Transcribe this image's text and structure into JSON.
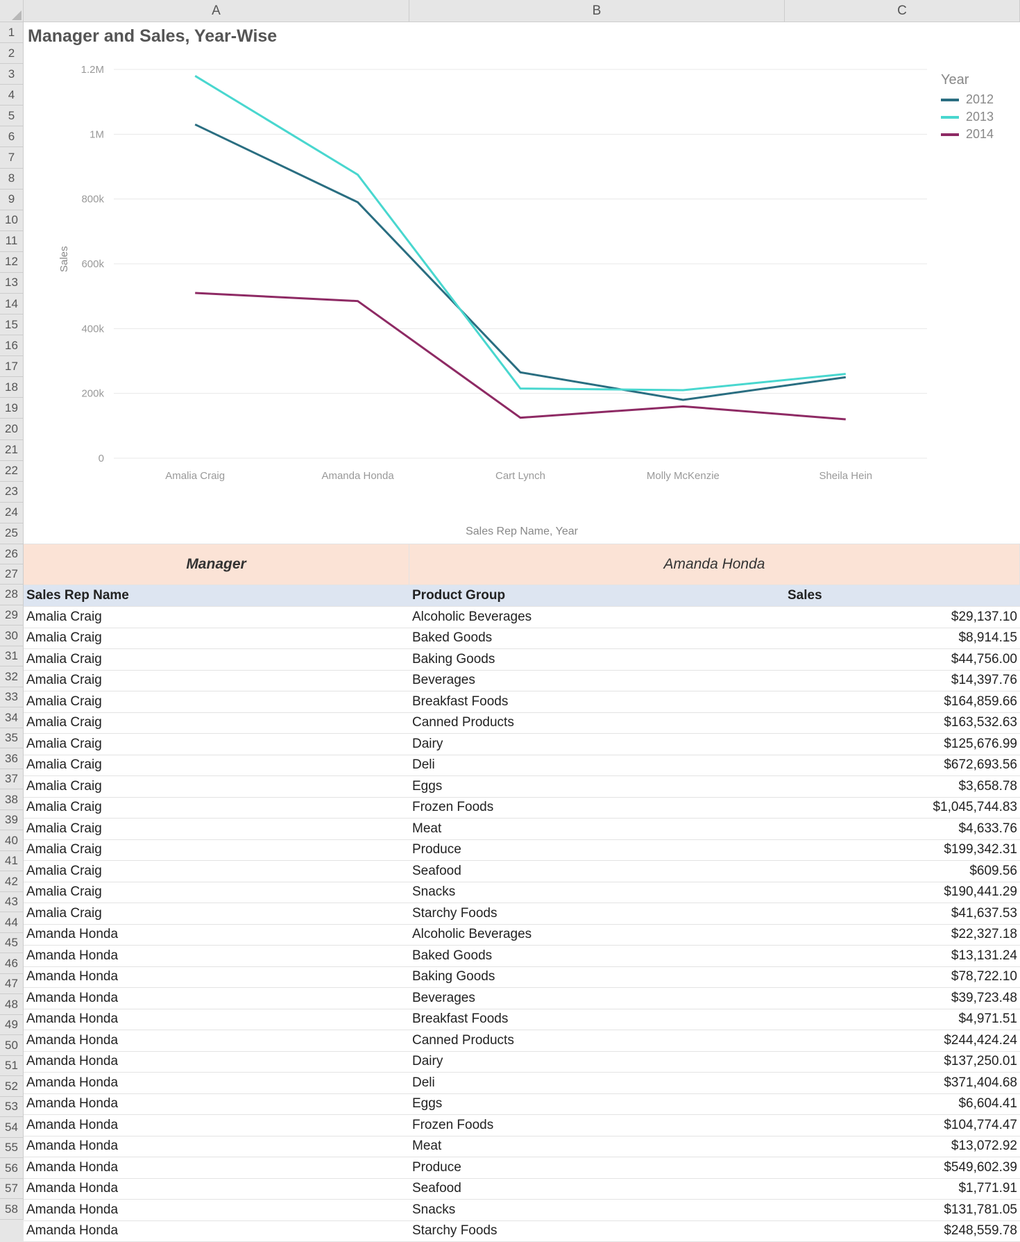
{
  "columns": [
    "A",
    "B",
    "C"
  ],
  "row_numbers_start": 1,
  "row_numbers_end": 58,
  "chart_title": "Manager and Sales, Year-Wise",
  "axis": {
    "ylabel": "Sales",
    "xtitle": "Sales Rep Name, Year"
  },
  "legend": {
    "title": "Year",
    "items": [
      {
        "name": "2012",
        "color": "#2a6e81"
      },
      {
        "name": "2013",
        "color": "#49d7cf"
      },
      {
        "name": "2014",
        "color": "#8e2a64"
      }
    ]
  },
  "chart_data": {
    "type": "line",
    "categories": [
      "Amalia Craig",
      "Amanda Honda",
      "Cart Lynch",
      "Molly McKenzie",
      "Sheila Hein"
    ],
    "series": [
      {
        "name": "2012",
        "color": "#2a6e81",
        "values": [
          1030000,
          790000,
          265000,
          180000,
          250000
        ]
      },
      {
        "name": "2013",
        "color": "#49d7cf",
        "values": [
          1180000,
          875000,
          215000,
          210000,
          260000
        ]
      },
      {
        "name": "2014",
        "color": "#8e2a64",
        "values": [
          510000,
          485000,
          125000,
          160000,
          120000
        ]
      }
    ],
    "title": "Manager and Sales, Year-Wise",
    "xlabel": "Sales Rep Name, Year",
    "ylabel": "Sales",
    "ylim": [
      0,
      1200000
    ],
    "y_ticks": [
      0,
      200000,
      400000,
      600000,
      800000,
      1000000,
      1200000
    ],
    "y_tick_labels": [
      "0",
      "200k",
      "400k",
      "600k",
      "800k",
      "1M",
      "1.2M"
    ]
  },
  "manager_band": {
    "label": "Manager",
    "value": "Amanda Honda"
  },
  "table": {
    "headers": [
      "Sales Rep Name",
      "Product Group",
      "Sales"
    ],
    "rows": [
      [
        "Amalia Craig",
        "Alcoholic Beverages",
        "$29,137.10"
      ],
      [
        "Amalia Craig",
        "Baked Goods",
        "$8,914.15"
      ],
      [
        "Amalia Craig",
        "Baking Goods",
        "$44,756.00"
      ],
      [
        "Amalia Craig",
        "Beverages",
        "$14,397.76"
      ],
      [
        "Amalia Craig",
        "Breakfast Foods",
        "$164,859.66"
      ],
      [
        "Amalia Craig",
        "Canned Products",
        "$163,532.63"
      ],
      [
        "Amalia Craig",
        "Dairy",
        "$125,676.99"
      ],
      [
        "Amalia Craig",
        "Deli",
        "$672,693.56"
      ],
      [
        "Amalia Craig",
        "Eggs",
        "$3,658.78"
      ],
      [
        "Amalia Craig",
        "Frozen Foods",
        "$1,045,744.83"
      ],
      [
        "Amalia Craig",
        "Meat",
        "$4,633.76"
      ],
      [
        "Amalia Craig",
        "Produce",
        "$199,342.31"
      ],
      [
        "Amalia Craig",
        "Seafood",
        "$609.56"
      ],
      [
        "Amalia Craig",
        "Snacks",
        "$190,441.29"
      ],
      [
        "Amalia Craig",
        "Starchy Foods",
        "$41,637.53"
      ],
      [
        "Amanda Honda",
        "Alcoholic Beverages",
        "$22,327.18"
      ],
      [
        "Amanda Honda",
        "Baked Goods",
        "$13,131.24"
      ],
      [
        "Amanda Honda",
        "Baking Goods",
        "$78,722.10"
      ],
      [
        "Amanda Honda",
        "Beverages",
        "$39,723.48"
      ],
      [
        "Amanda Honda",
        "Breakfast Foods",
        "$4,971.51"
      ],
      [
        "Amanda Honda",
        "Canned Products",
        "$244,424.24"
      ],
      [
        "Amanda Honda",
        "Dairy",
        "$137,250.01"
      ],
      [
        "Amanda Honda",
        "Deli",
        "$371,404.68"
      ],
      [
        "Amanda Honda",
        "Eggs",
        "$6,604.41"
      ],
      [
        "Amanda Honda",
        "Frozen Foods",
        "$104,774.47"
      ],
      [
        "Amanda Honda",
        "Meat",
        "$13,072.92"
      ],
      [
        "Amanda Honda",
        "Produce",
        "$549,602.39"
      ],
      [
        "Amanda Honda",
        "Seafood",
        "$1,771.91"
      ],
      [
        "Amanda Honda",
        "Snacks",
        "$131,781.05"
      ],
      [
        "Amanda Honda",
        "Starchy Foods",
        "$248,559.78"
      ]
    ]
  }
}
